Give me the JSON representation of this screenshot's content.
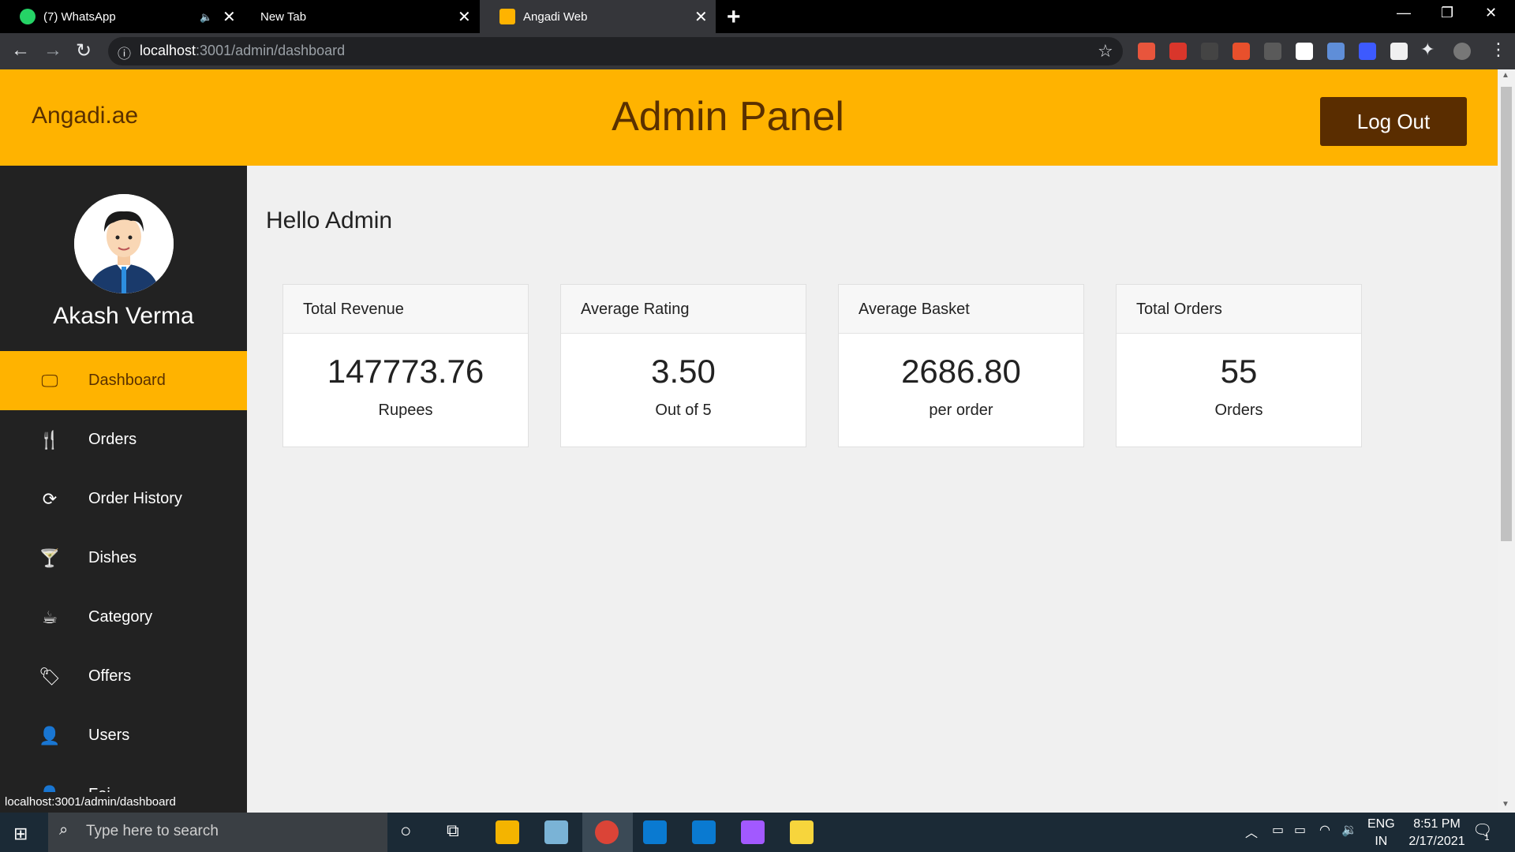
{
  "browser": {
    "tabs": [
      {
        "title": "(7) WhatsApp"
      },
      {
        "title": "New Tab"
      },
      {
        "title": "Angadi Web"
      }
    ],
    "url_host": "localhost",
    "url_path": ":3001/admin/dashboard",
    "status_url": "localhost:3001/admin/dashboard"
  },
  "header": {
    "brand": "Angadi.ae",
    "title": "Admin Panel",
    "logout_label": "Log Out"
  },
  "sidebar": {
    "user_name": "Akash Verma",
    "items": [
      {
        "label": "Dashboard",
        "icon": "monitor-icon"
      },
      {
        "label": "Orders",
        "icon": "cutlery-icon"
      },
      {
        "label": "Order History",
        "icon": "refresh-icon"
      },
      {
        "label": "Dishes",
        "icon": "cocktail-icon"
      },
      {
        "label": "Category",
        "icon": "coffee-icon"
      },
      {
        "label": "Offers",
        "icon": "tag-icon"
      },
      {
        "label": "Users",
        "icon": "user-icon"
      },
      {
        "label": "Fei...",
        "icon": "user-icon"
      }
    ]
  },
  "main": {
    "greeting": "Hello Admin",
    "cards": [
      {
        "title": "Total Revenue",
        "value": "147773.76",
        "unit": "Rupees"
      },
      {
        "title": "Average Rating",
        "value": "3.50",
        "unit": "Out of 5"
      },
      {
        "title": "Average Basket",
        "value": "2686.80",
        "unit": "per order"
      },
      {
        "title": "Total Orders",
        "value": "55",
        "unit": "Orders"
      }
    ]
  },
  "taskbar": {
    "search_placeholder": "Type here to search",
    "lang": "ENG",
    "region": "IN",
    "time": "8:51 PM",
    "date": "2/17/2021",
    "notif_count": "1"
  },
  "colors": {
    "accent": "#ffb300",
    "brown": "#5a3000",
    "sidebar_bg": "#222222"
  }
}
